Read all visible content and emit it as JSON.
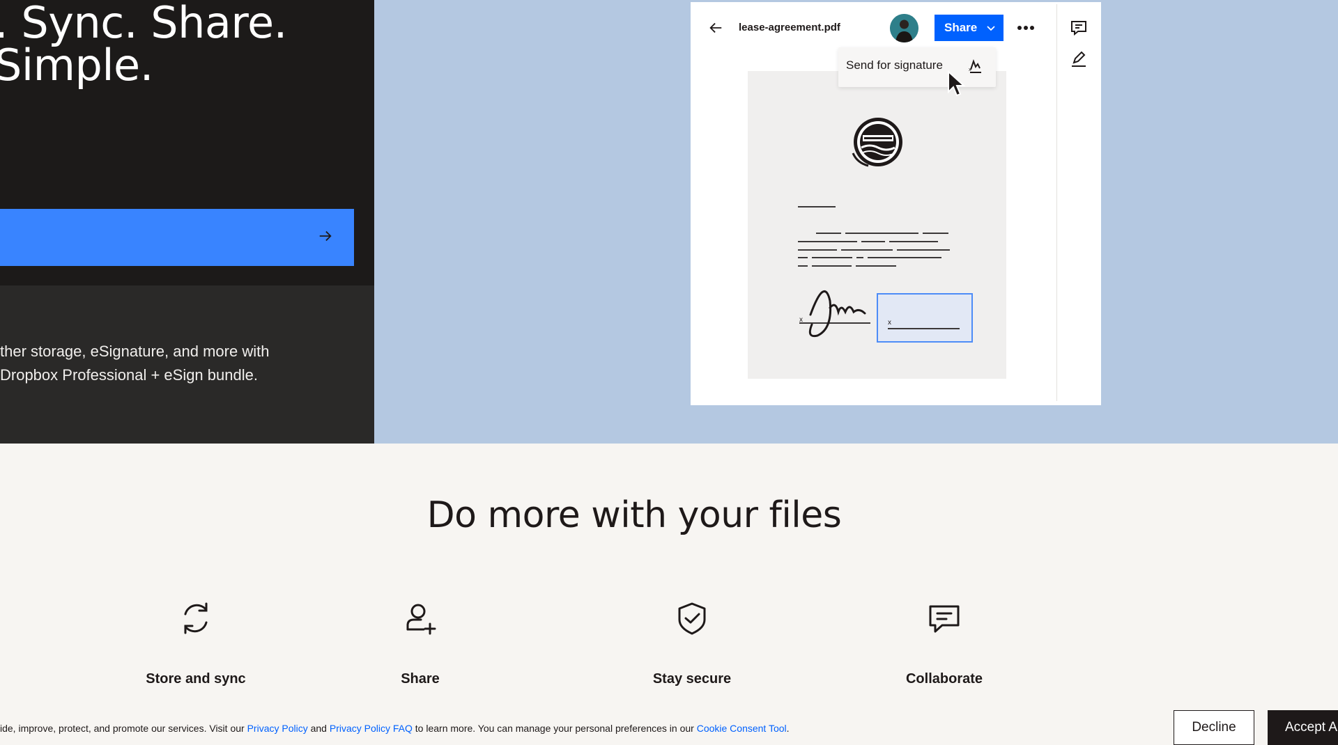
{
  "hero": {
    "title_lines": [
      ". Sync. Share.",
      "Simple."
    ],
    "description_lines": [
      "ther storage, eSignature, and more with",
      " Dropbox Professional + eSign bundle."
    ],
    "cta_icon": "arrow-right-icon"
  },
  "mockup": {
    "filename": "lease-agreement.pdf",
    "share_label": "Share",
    "menu_item_label": "Send for signature",
    "icons": [
      "back-arrow-icon",
      "avatar",
      "chevron-down-icon",
      "more-icon",
      "comment-icon",
      "pencil-icon",
      "signature-icon",
      "cursor-icon",
      "seal-icon"
    ]
  },
  "features": {
    "title": "Do more with your files",
    "items": [
      {
        "label": "Store and sync",
        "icon": "sync-icon"
      },
      {
        "label": "Share",
        "icon": "share-user-icon"
      },
      {
        "label": "Stay secure",
        "icon": "shield-check-icon"
      },
      {
        "label": "Collaborate",
        "icon": "comment-icon"
      }
    ]
  },
  "cookie": {
    "text_1": "ide, improve, protect, and promote our services. Visit our ",
    "link_1": "Privacy Policy",
    "text_2": " and ",
    "link_2": "Privacy Policy FAQ",
    "text_3": " to learn more. You can manage your personal preferences in our ",
    "link_3": "Cookie Consent Tool",
    "text_4": ".",
    "decline_label": "Decline",
    "accept_label": "Accept A"
  },
  "colors": {
    "hero_dark": "#1e1919",
    "hero_dark_bottom": "#2a2928",
    "hero_blue_panel": "#b4c8e1",
    "cta_blue": "#3984ff",
    "share_blue": "#0061fe",
    "page_bg": "#f7f5f2"
  }
}
